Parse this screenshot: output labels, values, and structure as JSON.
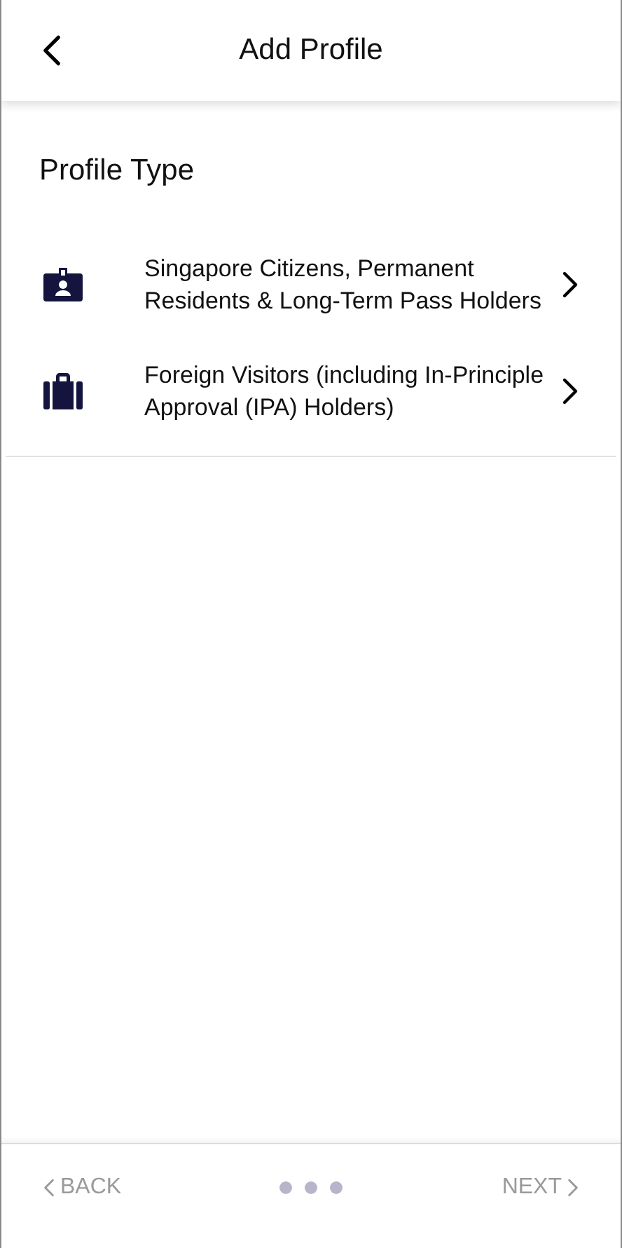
{
  "header": {
    "title": "Add Profile"
  },
  "section_title": "Profile Type",
  "options": [
    {
      "kind": "id-card",
      "label": "Singapore Citizens, Permanent Residents & Long-Term Pass Holders"
    },
    {
      "kind": "suitcase",
      "label": "Foreign Visitors (including In-Principle Approval (IPA) Holders)"
    }
  ],
  "footer": {
    "back": {
      "label": "BACK",
      "disabled": true
    },
    "next": {
      "label": "NEXT",
      "disabled": true
    }
  }
}
